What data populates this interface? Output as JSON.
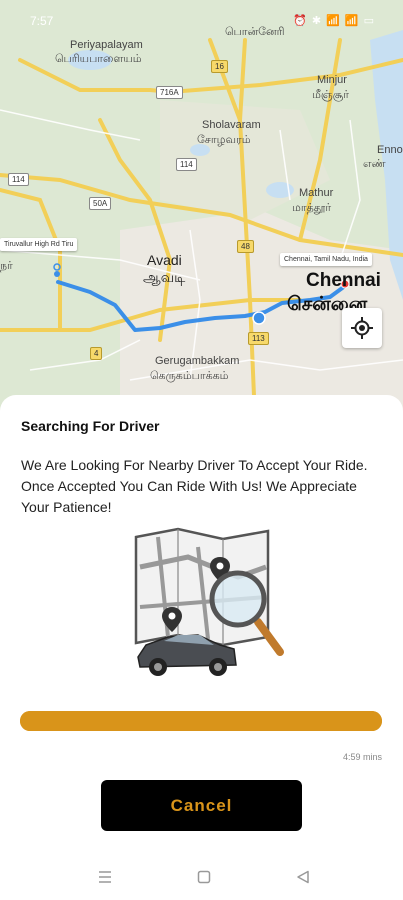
{
  "status_bar": {
    "time": "7:57",
    "icons": "⏰ ✱ 📶 📶 ▭"
  },
  "map": {
    "labels": {
      "periyapalayam_en": "Periyapalayam",
      "periyapalayam_ta": "பெரியபாளையம்",
      "ponneri_ta": "பொன்னேரி",
      "sholavaram_en": "Sholavaram",
      "sholavaram_ta": "சோழவரம்",
      "minjur_en": "Minjur",
      "minjur_ta": "மீஞ்சூர்",
      "ennore_en": "Enno",
      "ennore_ta": "எண்",
      "mathur_en": "Mathur",
      "mathur_ta": "மாத்தூர்",
      "avadi_en": "Avadi",
      "avadi_ta": "ஆவடி",
      "chennai_en": "Chennai",
      "chennai_ta": "சென்னை",
      "gerugambakkam_en": "Gerugambakkam",
      "gerugambakkam_ta": "கெருகம்பாக்கம்",
      "naru_ta": "நர்"
    },
    "shields": {
      "s16": "16",
      "s716a": "716A",
      "s114a": "114",
      "s114b": "114",
      "s50a": "50A",
      "s48": "48",
      "s113": "113",
      "s4": "4"
    },
    "pickup_callout": "Tiruvallur High Rd Tiru",
    "drop_callout": "Chennai, Tamil Nadu, India"
  },
  "sheet": {
    "title": "Searching For Driver",
    "description": "We Are Looking For Nearby Driver To Accept Your Ride. Once Accepted You Can Ride With Us! We Appreciate Your Patience!",
    "progress_fraction": 1.0,
    "timer_text": "4:59 mins",
    "cancel_label": "Cancel"
  },
  "colors": {
    "accent": "#d9941a",
    "route": "#3b8fe8",
    "button_bg": "#000000"
  },
  "icons": {
    "locate": "crosshair-icon",
    "nav_menu": "menu-lines-icon",
    "nav_home": "square-icon",
    "nav_back": "triangle-back-icon"
  }
}
